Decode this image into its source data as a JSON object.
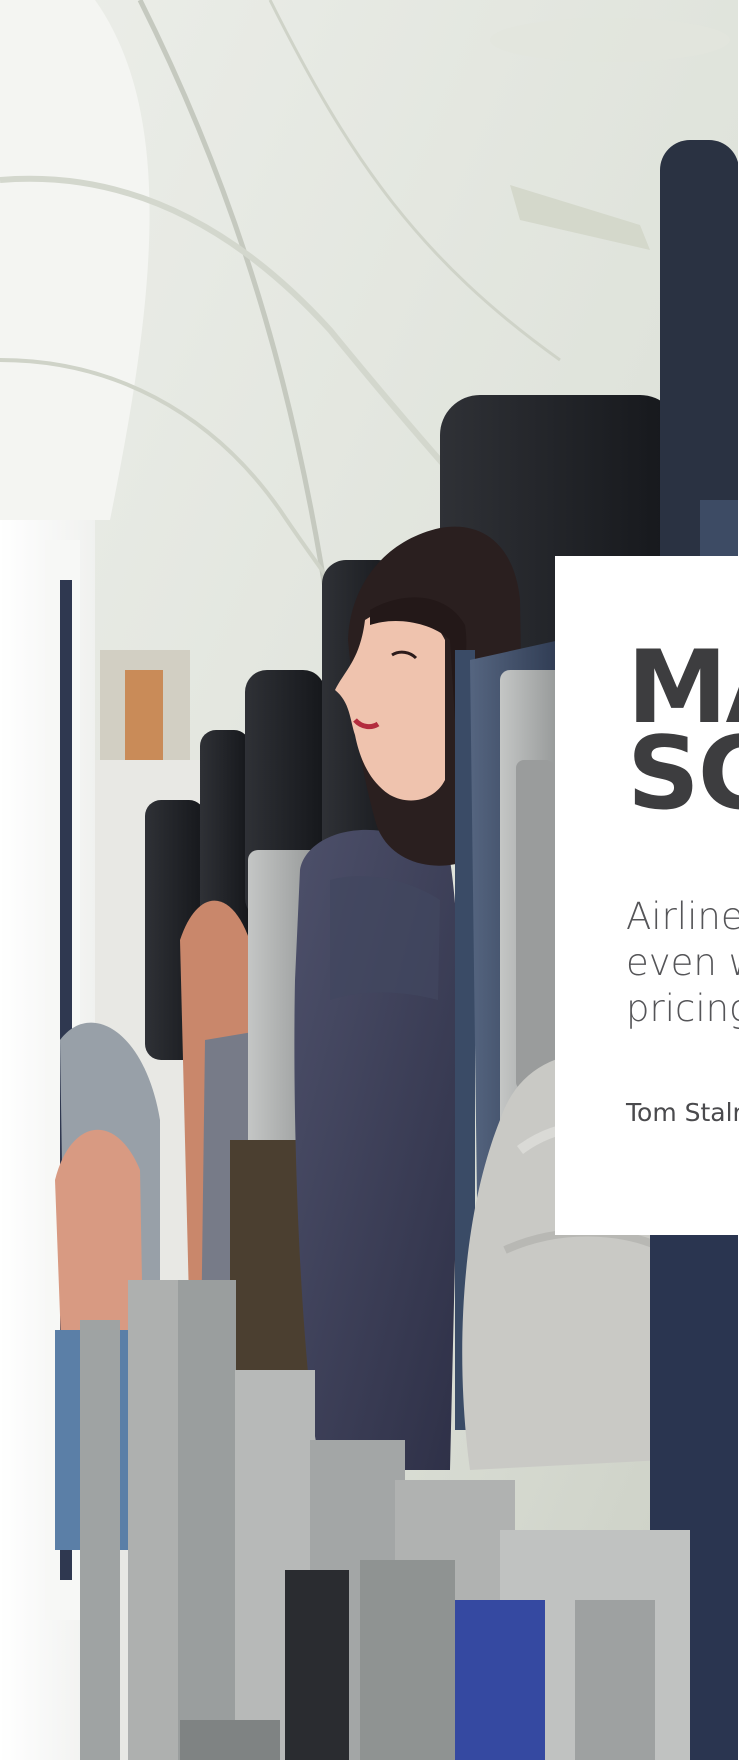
{
  "article": {
    "headline_line1": "MA",
    "headline_line2": "SC",
    "dek_line1": "Airline",
    "dek_line2": "even w",
    "dek_line3": "pricing",
    "byline": "Tom Stalr"
  },
  "colors": {
    "headline": "#3d3d3f",
    "dek": "#555558",
    "byline": "#4a4a4d",
    "card": "#ffffff"
  },
  "image": {
    "subject": "airplane-cabin-passenger-photo"
  }
}
